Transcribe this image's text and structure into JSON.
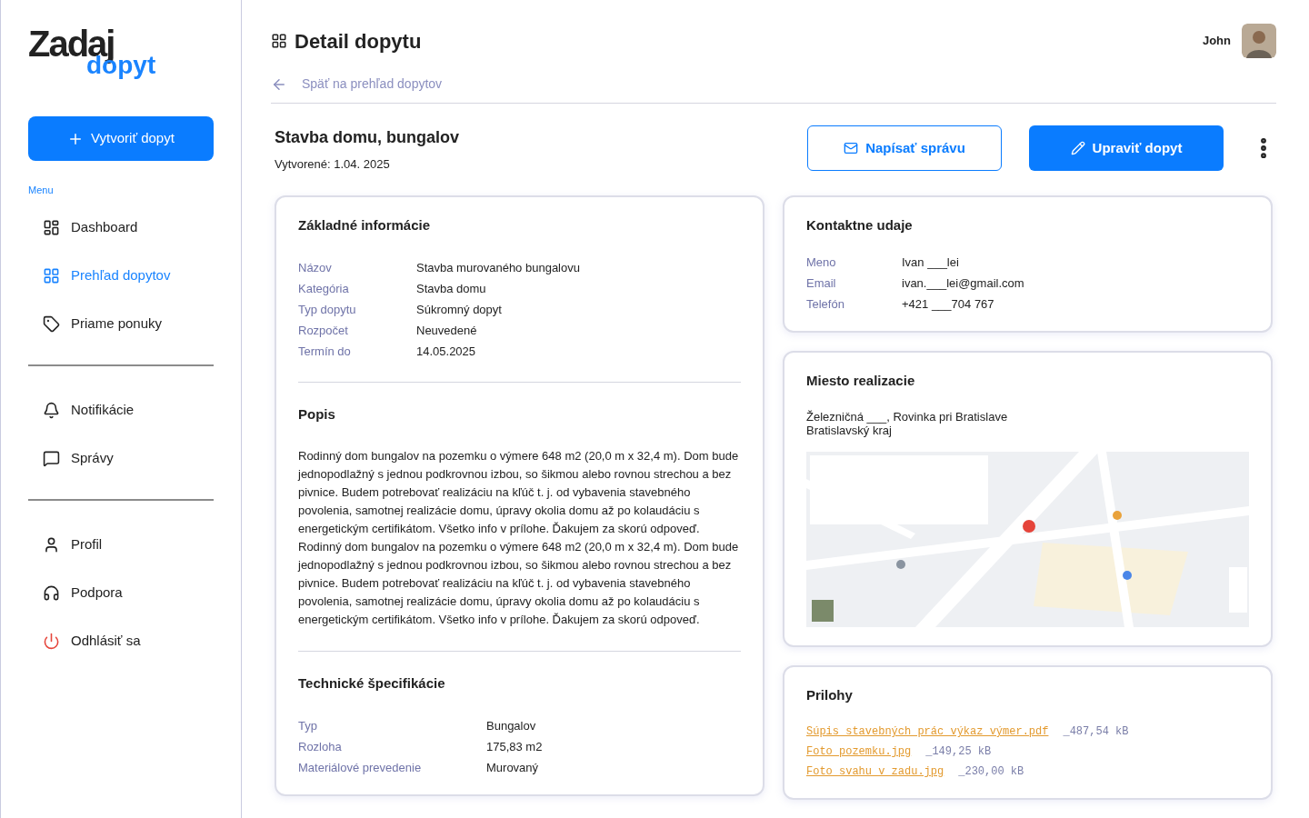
{
  "logo": {
    "word_1": "Zadaj",
    "word_2": "dopyt"
  },
  "sidebar": {
    "create_button": "Vytvoriť dopyt",
    "menu_label": "Menu",
    "sections": [
      {
        "items": [
          {
            "label": "Dashboard",
            "selected": false,
            "kind": "normal"
          },
          {
            "label": "Prehľad dopytov",
            "selected": true,
            "kind": "normal"
          },
          {
            "label": "Priame ponuky",
            "selected": false,
            "kind": "normal"
          }
        ]
      },
      {
        "items": [
          {
            "label": "Notifikácie",
            "selected": false,
            "kind": "normal"
          },
          {
            "label": "Správy",
            "selected": false,
            "kind": "normal"
          }
        ]
      },
      {
        "items": [
          {
            "label": "Profil",
            "selected": false,
            "kind": "normal"
          },
          {
            "label": "Podpora",
            "selected": false,
            "kind": "normal"
          },
          {
            "label": "Odhlásiť sa",
            "selected": false,
            "kind": "logout"
          }
        ]
      }
    ]
  },
  "header": {
    "title": "Detail dopytu",
    "user": "John",
    "back_link": "Späť na prehľad dopytov"
  },
  "request": {
    "title": "Stavba domu, bungalov",
    "created": "Vytvorené: 1.04. 2025",
    "buttons": [
      {
        "label": "Napísať správu",
        "kind": "secondary"
      },
      {
        "label": "Upraviť dopyt",
        "kind": "primary"
      }
    ]
  },
  "basic_info": {
    "heading": "Základné informácie",
    "rows": [
      {
        "label": "Názov",
        "value": "Stavba murovaného bungalovu"
      },
      {
        "label": "Kategória",
        "value": "Stavba domu"
      },
      {
        "label": "Typ dopytu",
        "value": "Súkromný dopyt"
      },
      {
        "label": "Rozpočet",
        "value": "Neuvedené"
      },
      {
        "label": "Termín do",
        "value": "14.05.2025"
      }
    ]
  },
  "description": {
    "heading": "Popis",
    "paragraphs": [
      "Rodinný dom bungalov na pozemku o výmere 648 m2 (20,0 m x 32,4 m). Dom bude jednopodlažný s jednou podkrovnou izbou, so šikmou alebo rovnou strechou a bez pivnice. Budem potrebovať realizáciu na kľúč t. j. od vybavenia stavebného povolenia, samotnej realizácie domu, úpravy okolia domu až po kolaudáciu s energetickým certifikátom. Všetko info v prílohe. Ďakujem za skorú odpoveď.",
      "Rodinný dom bungalov na pozemku o výmere 648 m2 (20,0 m x 32,4 m). Dom bude jednopodlažný s jednou podkrovnou izbou, so šikmou alebo rovnou strechou a bez pivnice. Budem potrebovať realizáciu na kľúč t. j. od vybavenia stavebného povolenia, samotnej realizácie domu, úpravy okolia domu až po kolaudáciu s energetickým certifikátom. Všetko info v prílohe. Ďakujem za skorú odpoveď."
    ]
  },
  "tech_specs": {
    "heading": "Technické špecifikácie",
    "rows": [
      {
        "label": "Typ",
        "value": "Bungalov"
      },
      {
        "label": "Rozloha",
        "value": "175,83 m2"
      },
      {
        "label": "Materiálové prevedenie",
        "value": "Murovaný"
      }
    ]
  },
  "contact": {
    "heading": "Kontaktne udaje",
    "rows": [
      {
        "label": "Meno",
        "value": "Ivan ___lei"
      },
      {
        "label": "Email",
        "value": "ivan.___lei@gmail.com"
      },
      {
        "label": "Telefón",
        "value": "+421 ___704 767"
      }
    ]
  },
  "location": {
    "heading": "Miesto realizacie",
    "address_lines": [
      "Železničná ___, Rovinka pri Bratislave",
      "Bratislavský kraj"
    ],
    "map": {
      "kind": "picture"
    }
  },
  "attachments": {
    "heading": "Prilohy",
    "files": [
      {
        "name": "Súpis stavebných prác výkaz výmer.pdf",
        "size": "_487,54 kB"
      },
      {
        "name": "Foto pozemku.jpg",
        "size": "_149,25 kB"
      },
      {
        "name": "Foto svahu v zadu.jpg",
        "size": "_230,00 kB"
      }
    ]
  }
}
